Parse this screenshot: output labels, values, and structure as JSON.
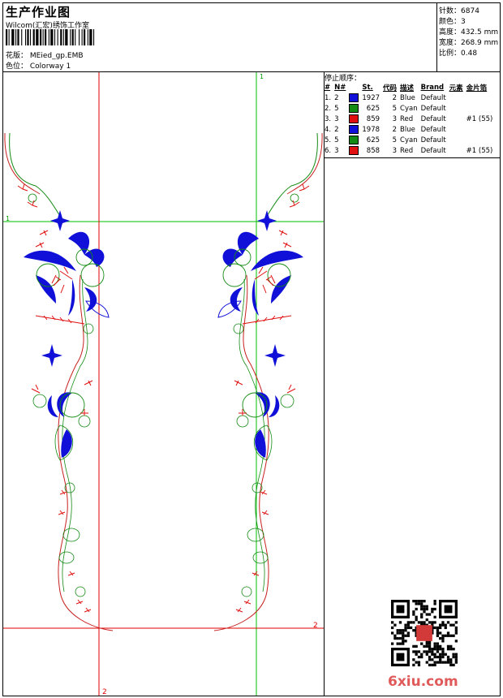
{
  "header": {
    "title": "生产作业图",
    "company": "Wilcom(汇宏)绣饰工作室",
    "design_label": "花版：",
    "design_value": "MEied_gp.EMB",
    "colorway_label": "色位：",
    "colorway_value": "Colorway 1"
  },
  "stats": {
    "stitches_label": "针数：",
    "stitches_value": "6874",
    "colors_label": "颜色：",
    "colors_value": "3",
    "height_label": "高度：",
    "height_value": "432.5 mm",
    "width_label": "宽度：",
    "width_value": "268.9 mm",
    "scale_label": "比例：",
    "scale_value": "0.48"
  },
  "sequence": {
    "heading": "停止顺序：",
    "columns": [
      "#",
      "N#",
      "St.",
      "代码",
      "描述",
      "Brand",
      "元素",
      "金片箔"
    ],
    "rows": [
      {
        "idx": "1.",
        "n": "2",
        "color": "#1010d8",
        "st": "1927",
        "code": "2",
        "desc": "Blue",
        "brand": "Default",
        "elem": "",
        "seq": ""
      },
      {
        "idx": "2.",
        "n": "5",
        "color": "#138a13",
        "st": "625",
        "code": "5",
        "desc": "Cyan",
        "brand": "Default",
        "elem": "",
        "seq": ""
      },
      {
        "idx": "3.",
        "n": "3",
        "color": "#e01010",
        "st": "859",
        "code": "3",
        "desc": "Red",
        "brand": "Default",
        "elem": "",
        "seq": "#1 (55)"
      },
      {
        "idx": "4.",
        "n": "2",
        "color": "#1010d8",
        "st": "1978",
        "code": "2",
        "desc": "Blue",
        "brand": "Default",
        "elem": "",
        "seq": ""
      },
      {
        "idx": "5.",
        "n": "5",
        "color": "#138a13",
        "st": "625",
        "code": "5",
        "desc": "Cyan",
        "brand": "Default",
        "elem": "",
        "seq": ""
      },
      {
        "idx": "6.",
        "n": "3",
        "color": "#e01010",
        "st": "858",
        "code": "3",
        "desc": "Red",
        "brand": "Default",
        "elem": "",
        "seq": "#1 (55)"
      }
    ]
  },
  "guides": {
    "label_1a": "1",
    "label_1b": "1",
    "label_2a": "2",
    "label_2b": "2"
  },
  "watermark": "6xiu.com",
  "colors": {
    "guide_green": "#00c000",
    "guide_red": "#e00000",
    "thread_blue": "#1010d8",
    "thread_red": "#e01010",
    "thread_green": "#138a13"
  }
}
